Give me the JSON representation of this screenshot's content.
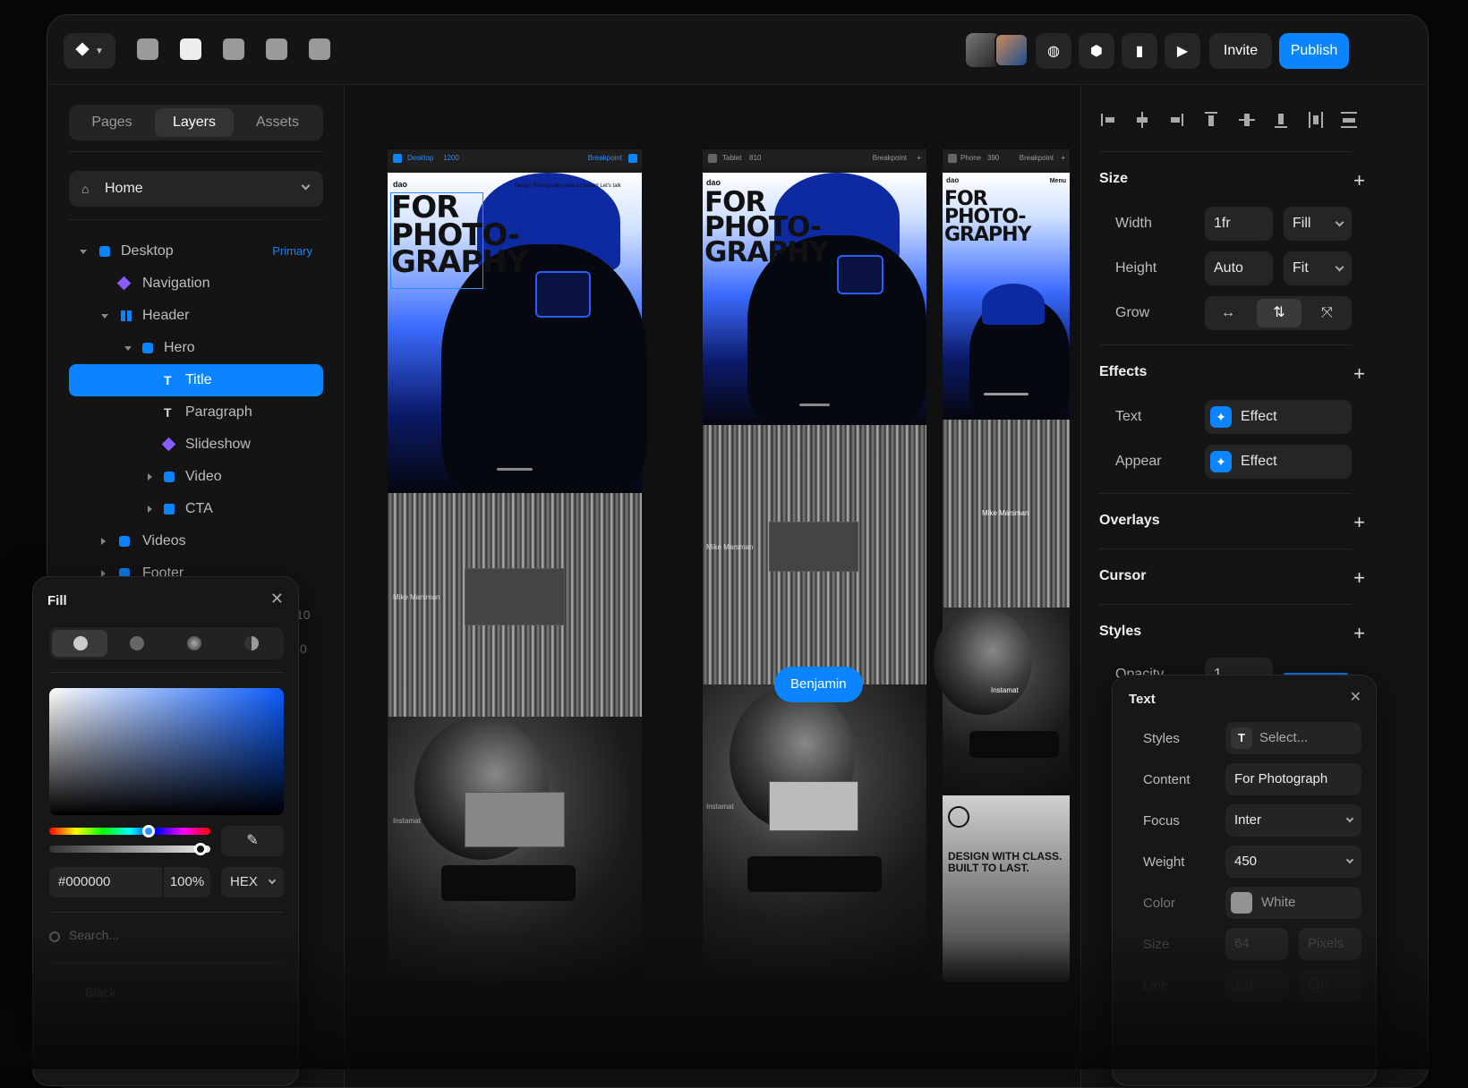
{
  "toolbar": {
    "tool_icons": [
      "framer-logo-icon",
      "insert-icon",
      "layout-icon",
      "text-icon",
      "cms-icon",
      "components-icon"
    ],
    "right_icons": [
      "globe-icon",
      "settings-icon",
      "analytics-icon",
      "play-icon"
    ],
    "invite_label": "Invite",
    "publish_label": "Publish",
    "accent": "#0a84ff"
  },
  "left_panel": {
    "tabs": [
      "Pages",
      "Layers",
      "Assets"
    ],
    "active_tab": "Layers",
    "page_select": "Home",
    "layers": [
      {
        "label": "Desktop",
        "badge": "Primary",
        "icon": "stack-icon"
      },
      {
        "label": "Navigation",
        "icon": "component-icon"
      },
      {
        "label": "Header",
        "icon": "columns-icon"
      },
      {
        "label": "Hero",
        "icon": "stack-icon"
      },
      {
        "label": "Title",
        "icon": "text-icon",
        "selected": true
      },
      {
        "label": "Paragraph",
        "icon": "text-icon"
      },
      {
        "label": "Slideshow",
        "icon": "component-icon"
      },
      {
        "label": "Video",
        "icon": "stack-icon"
      },
      {
        "label": "CTA",
        "icon": "frame-icon"
      },
      {
        "label": "Videos",
        "icon": "stack-icon"
      },
      {
        "label": "Footer",
        "icon": "stack-icon"
      }
    ],
    "peek_values": [
      "10",
      "0"
    ]
  },
  "fill_panel": {
    "title": "Fill",
    "hex": "#000000",
    "opacity": "100%",
    "format": "HEX",
    "search_placeholder": "Search...",
    "bottom_item": "Black",
    "hue_slider": 0.61,
    "alpha_slider": 1
  },
  "canvas": {
    "frames": [
      {
        "name": "Desktop",
        "width": "1200",
        "breakpoint": "Breakpoint",
        "active": true
      },
      {
        "name": "Tablet",
        "width": "810",
        "breakpoint": "Breakpoint"
      },
      {
        "name": "Phone",
        "width": "390",
        "breakpoint": "Breakpoint"
      }
    ],
    "site_logo": "dao",
    "nav": "Design  Photography  About  Contact  Let's talk",
    "phone_nav": "Menu",
    "hero_title": "FOR PHOTO-GRAPHY",
    "person_name": "Mike Marsman",
    "project_name": "Instamat",
    "footer_title": "DESIGN WITH CLASS. BUILT TO LAST.",
    "collaborator": "Benjamin"
  },
  "right_panel": {
    "align_icons": [
      "align-left-icon",
      "align-hcenter-icon",
      "align-right-icon",
      "align-top-icon",
      "align-vcenter-icon",
      "align-bottom-icon",
      "distribute-h-icon",
      "distribute-v-icon"
    ],
    "size": {
      "title": "Size",
      "width_label": "Width",
      "width_value": "1fr",
      "width_mode": "Fill",
      "height_label": "Height",
      "height_value": "Auto",
      "height_mode": "Fit",
      "grow_label": "Grow"
    },
    "effects": {
      "title": "Effects",
      "text_label": "Text",
      "appear_label": "Appear",
      "effect_label": "Effect"
    },
    "overlays": "Overlays",
    "cursor": "Cursor",
    "styles": {
      "title": "Styles",
      "opacity_label": "Opacity",
      "opacity_value": "1"
    }
  },
  "text_panel": {
    "title": "Text",
    "styles_label": "Styles",
    "styles_value": "Select...",
    "content_label": "Content",
    "content_value": "For Photograph",
    "focus_label": "Focus",
    "focus_value": "Inter",
    "weight_label": "Weight",
    "weight_value": "450",
    "color_label": "Color",
    "color_value": "White",
    "size_label": "Size",
    "size_value": "64",
    "size_unit": "Pixels",
    "line_label": "Line",
    "line_value": "1.0",
    "line_unit": "Em"
  }
}
